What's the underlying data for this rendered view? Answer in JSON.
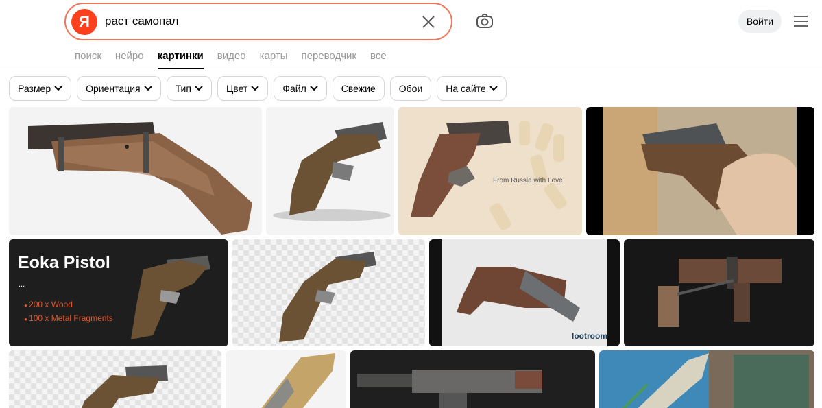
{
  "search": {
    "query": "раст самопал",
    "logo_letter": "Я"
  },
  "header": {
    "login_label": "Войти"
  },
  "tabs": [
    "поиск",
    "нейро",
    "картинки",
    "видео",
    "карты",
    "переводчик",
    "все"
  ],
  "filters": [
    "Размер",
    "Ориентация",
    "Тип",
    "Цвет",
    "Файл",
    "Свежие",
    "Обои",
    "На сайте"
  ],
  "results": {
    "eoka": {
      "title": "Eoka Pistol",
      "dots": "...",
      "items": [
        "200 x Wood",
        "100 x Metal Fragments"
      ]
    },
    "watermark": "lootroom",
    "sketch_note": "From Russia with Love"
  }
}
